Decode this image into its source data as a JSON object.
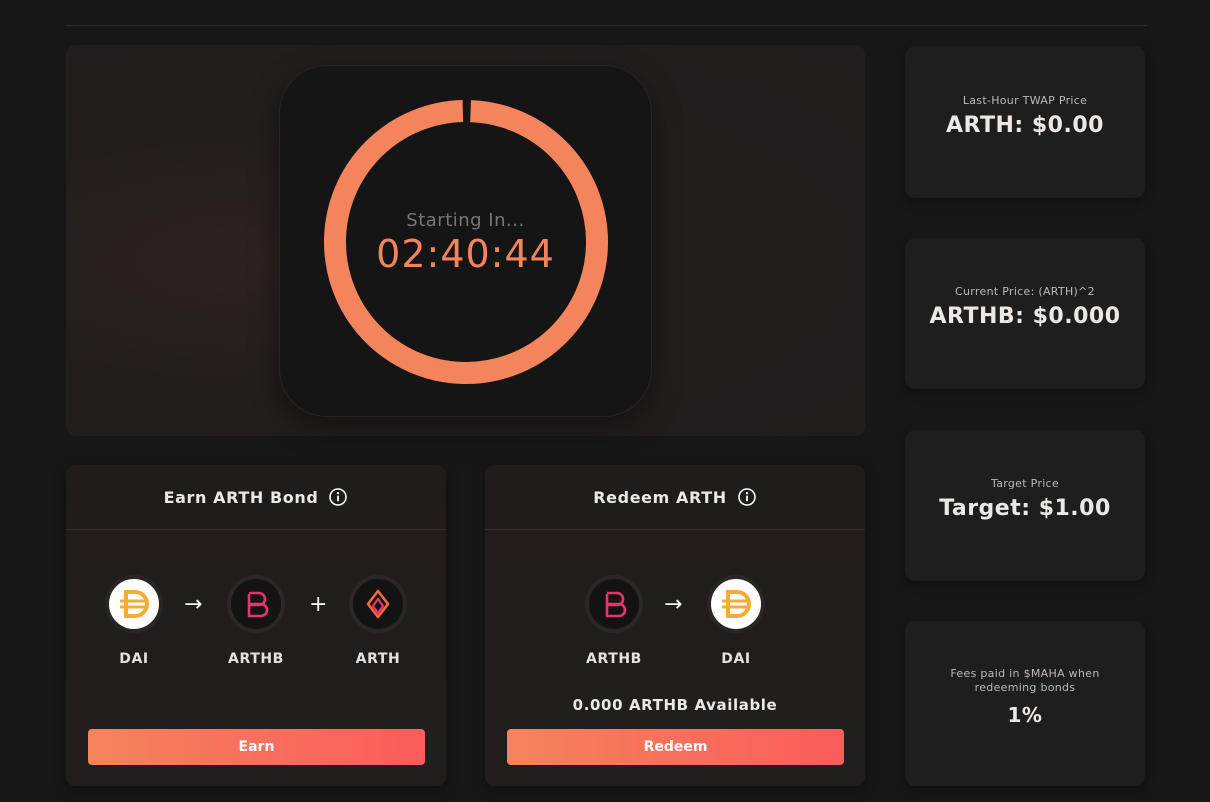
{
  "timer": {
    "label": "Starting In...",
    "value": "02:40:44",
    "ring_color": "#f4845b",
    "progress": 1.0
  },
  "stats": [
    {
      "label": "Last-Hour TWAP Price",
      "value": "ARTH: $0.00"
    },
    {
      "label": "Current Price: (ARTH)^2",
      "value": "ARTHB: $0.000"
    },
    {
      "label": "Target Price",
      "value": "Target: $1.00"
    },
    {
      "label_line1": "Fees paid in $MAHA when",
      "label_line2": "redeeming bonds",
      "value": "1%"
    }
  ],
  "earn": {
    "title": "Earn ARTH Bond",
    "tokens": [
      {
        "label": "DAI",
        "icon": "dai-icon"
      },
      {
        "label": "ARTHB",
        "icon": "arthb-icon"
      },
      {
        "label": "ARTH",
        "icon": "arth-icon"
      }
    ],
    "arrow": "→",
    "plus": "+",
    "button": "Earn"
  },
  "redeem": {
    "title": "Redeem ARTH",
    "tokens": [
      {
        "label": "ARTHB",
        "icon": "arthb-icon"
      },
      {
        "label": "DAI",
        "icon": "dai-icon"
      }
    ],
    "arrow": "→",
    "available": "0.000 ARTHB Available",
    "button": "Redeem"
  },
  "colors": {
    "accent_start": "#f4845b",
    "accent_end": "#fb5c5c",
    "dai": "#f5ac37",
    "arthb": "#e8336d",
    "arth": "#f06a3a"
  }
}
